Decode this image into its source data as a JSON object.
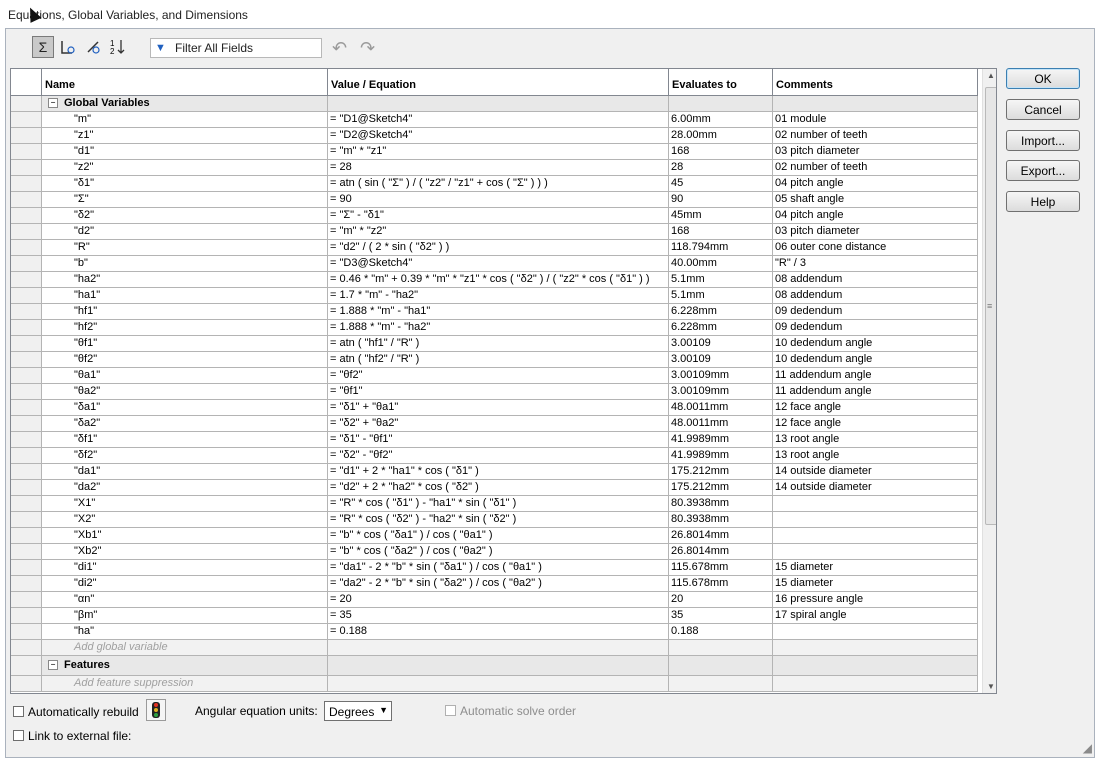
{
  "window": {
    "title": "Equations, Global Variables, and Dimensions"
  },
  "toolbar": {
    "filter_placeholder": "Filter All Fields",
    "icons": [
      "equation-view-icon",
      "sketch-equation-view-icon",
      "dimension-view-icon",
      "ordered-view-icon",
      "filter-icon",
      "undo-icon",
      "redo-icon"
    ]
  },
  "table": {
    "headers": {
      "name": "Name",
      "value": "Value / Equation",
      "evaluates": "Evaluates to",
      "comments": "Comments"
    },
    "global_group": "Global Variables",
    "rows": [
      {
        "name": "\"m\"",
        "value": "= \"D1@Sketch4\"",
        "eval": "6.00mm",
        "comment": "01 module"
      },
      {
        "name": "\"z1\"",
        "value": "= \"D2@Sketch4\"",
        "eval": "28.00mm",
        "comment": "02 number of teeth"
      },
      {
        "name": "\"d1\"",
        "value": "= \"m\" * \"z1\"",
        "eval": "168",
        "comment": "03 pitch diameter"
      },
      {
        "name": "\"z2\"",
        "value": "= 28",
        "eval": "28",
        "comment": "02 number of teeth"
      },
      {
        "name": "\"δ1\"",
        "value": "= atn ( sin ( \"Σ\" ) / ( \"z2\" / \"z1\" + cos ( \"Σ\" ) ) )",
        "eval": "45",
        "comment": "04 pitch angle"
      },
      {
        "name": "\"Σ\"",
        "value": "= 90",
        "eval": "90",
        "comment": "05 shaft angle"
      },
      {
        "name": "\"δ2\"",
        "value": "= \"Σ\" - \"δ1\"",
        "eval": "45mm",
        "comment": "04 pitch angle"
      },
      {
        "name": "\"d2\"",
        "value": "= \"m\" * \"z2\"",
        "eval": "168",
        "comment": "03 pitch diameter"
      },
      {
        "name": "\"R\"",
        "value": "= \"d2\" / ( 2 * sin ( \"δ2\" ) )",
        "eval": "118.794mm",
        "comment": "06 outer cone distance"
      },
      {
        "name": "\"b\"",
        "value": "= \"D3@Sketch4\"",
        "eval": "40.00mm",
        "comment": "\"R\" / 3"
      },
      {
        "name": "\"ha2\"",
        "value": "= 0.46 * \"m\" + 0.39 * \"m\" * \"z1\" * cos ( \"δ2\" ) / ( \"z2\" * cos ( \"δ1\" ) )",
        "eval": "5.1mm",
        "comment": "08 addendum"
      },
      {
        "name": "\"ha1\"",
        "value": "= 1.7 * \"m\" - \"ha2\"",
        "eval": "5.1mm",
        "comment": "08 addendum"
      },
      {
        "name": "\"hf1\"",
        "value": "= 1.888 * \"m\" - \"ha1\"",
        "eval": "6.228mm",
        "comment": "09 dedendum"
      },
      {
        "name": "\"hf2\"",
        "value": "= 1.888 * \"m\" - \"ha2\"",
        "eval": "6.228mm",
        "comment": "09 dedendum"
      },
      {
        "name": "\"θf1\"",
        "value": "= atn ( \"hf1\" / \"R\" )",
        "eval": "3.00109",
        "comment": "10 dedendum angle"
      },
      {
        "name": "\"θf2\"",
        "value": "= atn ( \"hf2\" / \"R\" )",
        "eval": "3.00109",
        "comment": "10 dedendum angle"
      },
      {
        "name": "\"θa1\"",
        "value": "= \"θf2\"",
        "eval": "3.00109mm",
        "comment": "11 addendum angle"
      },
      {
        "name": "\"θa2\"",
        "value": "= \"θf1\"",
        "eval": "3.00109mm",
        "comment": "11 addendum angle"
      },
      {
        "name": "\"δa1\"",
        "value": "= \"δ1\" + \"θa1\"",
        "eval": "48.0011mm",
        "comment": "12 face angle"
      },
      {
        "name": "\"δa2\"",
        "value": "= \"δ2\" + \"θa2\"",
        "eval": "48.0011mm",
        "comment": "12 face angle"
      },
      {
        "name": "\"δf1\"",
        "value": "= \"δ1\" - \"θf1\"",
        "eval": "41.9989mm",
        "comment": "13 root angle"
      },
      {
        "name": "\"δf2\"",
        "value": "= \"δ2\" - \"θf2\"",
        "eval": "41.9989mm",
        "comment": "13 root angle"
      },
      {
        "name": "\"da1\"",
        "value": "= \"d1\" + 2 * \"ha1\" * cos ( \"δ1\" )",
        "eval": "175.212mm",
        "comment": "14 outside diameter"
      },
      {
        "name": "\"da2\"",
        "value": "= \"d2\" + 2 * \"ha2\" * cos ( \"δ2\" )",
        "eval": "175.212mm",
        "comment": "14 outside diameter"
      },
      {
        "name": "\"X1\"",
        "value": "= \"R\" * cos ( \"δ1\" ) - \"ha1\" * sin ( \"δ1\" )",
        "eval": "80.3938mm",
        "comment": ""
      },
      {
        "name": "\"X2\"",
        "value": "= \"R\" * cos ( \"δ2\" ) - \"ha2\" * sin ( \"δ2\" )",
        "eval": "80.3938mm",
        "comment": ""
      },
      {
        "name": "\"Xb1\"",
        "value": "= \"b\" * cos ( \"δa1\" ) / cos ( \"θa1\" )",
        "eval": "26.8014mm",
        "comment": ""
      },
      {
        "name": "\"Xb2\"",
        "value": "= \"b\" * cos ( \"δa2\" ) / cos ( \"θa2\" )",
        "eval": "26.8014mm",
        "comment": ""
      },
      {
        "name": "\"di1\"",
        "value": "= \"da1\" - 2 * \"b\" * sin ( \"δa1\" ) / cos ( \"θa1\" )",
        "eval": "115.678mm",
        "comment": "15  diameter"
      },
      {
        "name": "\"di2\"",
        "value": "= \"da2\" - 2 * \"b\" * sin ( \"δa2\" ) / cos ( \"θa2\" )",
        "eval": "115.678mm",
        "comment": "15  diameter"
      },
      {
        "name": "\"αn\"",
        "value": "= 20",
        "eval": "20",
        "comment": "16 pressure angle"
      },
      {
        "name": "\"βm\"",
        "value": "= 35",
        "eval": "35",
        "comment": "17 spiral angle"
      },
      {
        "name": "\"ha\"",
        "value": "= 0.188",
        "eval": "0.188",
        "comment": ""
      }
    ],
    "add_global": "Add global variable",
    "features_group": "Features",
    "add_feature": "Add feature suppression"
  },
  "buttons": {
    "ok": "OK",
    "cancel": "Cancel",
    "import": "Import...",
    "export": "Export...",
    "help": "Help"
  },
  "bottom": {
    "auto_rebuild": "Automatically rebuild",
    "angular_units_label": "Angular equation units:",
    "angular_units_value": "Degrees",
    "auto_solve": "Automatic solve order",
    "link_external": "Link to external file:"
  }
}
